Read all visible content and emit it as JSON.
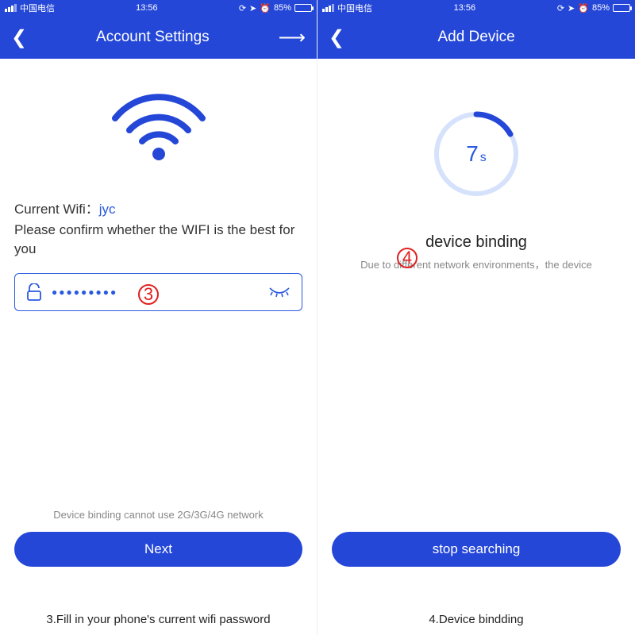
{
  "status": {
    "carrier": "中国电信",
    "time": "13:56",
    "battery_pct": "85%"
  },
  "left": {
    "title": "Account Settings",
    "wifi_label": "Current Wifi：",
    "wifi_name": "jyc",
    "advice": "Please confirm whether the WIFI is the best for you",
    "password_mask": "●●●●●●●●●",
    "note": "Device binding cannot use 2G/3G/4G network",
    "button": "Next",
    "badge": "3",
    "caption": "3.Fill in your phone's current wifi password"
  },
  "right": {
    "title": "Add Device",
    "countdown": "7",
    "countdown_unit": "s",
    "bind_title": "device binding",
    "bind_sub": "Due to different network environments，the device",
    "button": "stop searching",
    "badge": "4",
    "caption": "4.Device bindding"
  }
}
